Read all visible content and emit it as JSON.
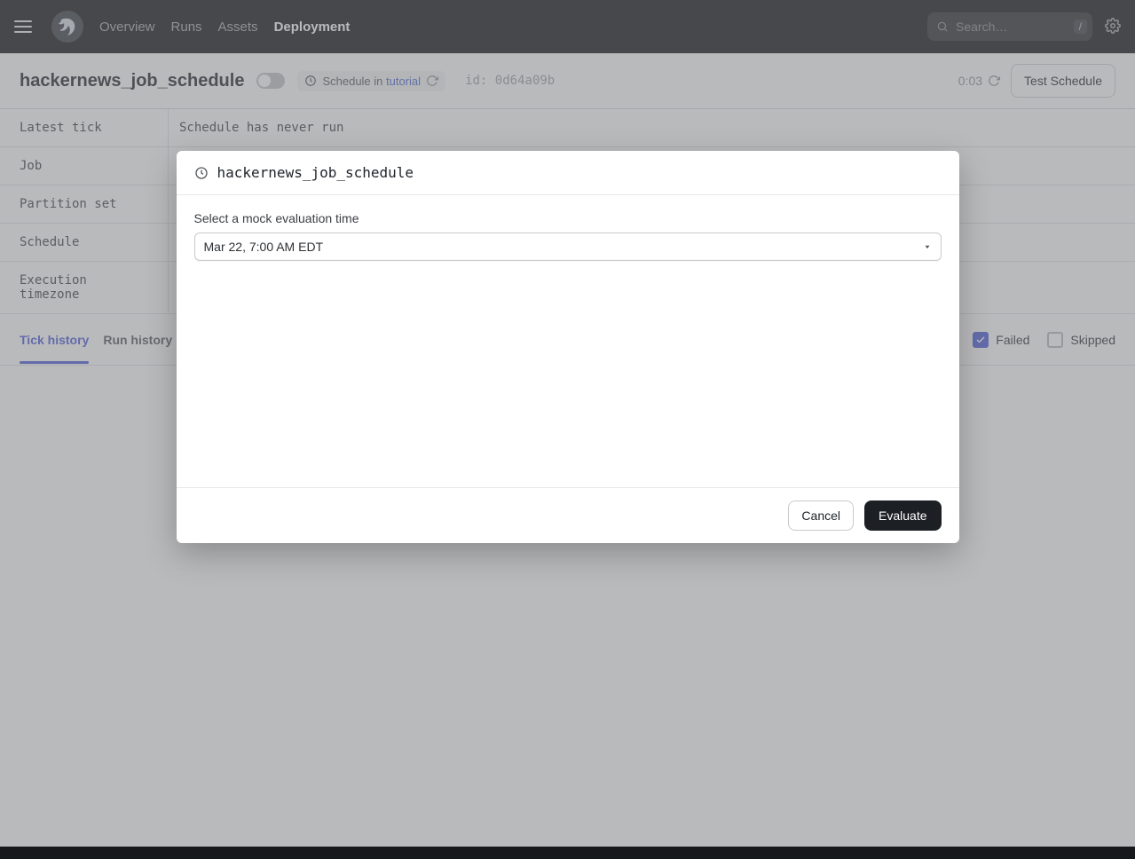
{
  "nav": {
    "items": [
      "Overview",
      "Runs",
      "Assets",
      "Deployment"
    ],
    "active_index": 3,
    "search_placeholder": "Search…",
    "slash": "/"
  },
  "page": {
    "title": "hackernews_job_schedule",
    "schedule_in_prefix": "Schedule in",
    "schedule_in_link": "tutorial",
    "id_label": "id:",
    "id_value": "0d64a09b",
    "countdown": "0:03",
    "test_button": "Test Schedule"
  },
  "info": {
    "rows": [
      {
        "label": "Latest tick",
        "value": "Schedule has never run"
      },
      {
        "label": "Job",
        "value": ""
      },
      {
        "label": "Partition set",
        "value": ""
      },
      {
        "label": "Schedule",
        "value": ""
      },
      {
        "label": "Execution timezone",
        "value": ""
      }
    ]
  },
  "tabs": {
    "items": [
      "Tick history",
      "Run history"
    ],
    "active_index": 0,
    "filters": {
      "failed": "Failed",
      "skipped": "Skipped"
    }
  },
  "dialog": {
    "title": "hackernews_job_schedule",
    "field_label": "Select a mock evaluation time",
    "select_value": "Mar 22, 7:00 AM EDT",
    "cancel": "Cancel",
    "evaluate": "Evaluate"
  }
}
